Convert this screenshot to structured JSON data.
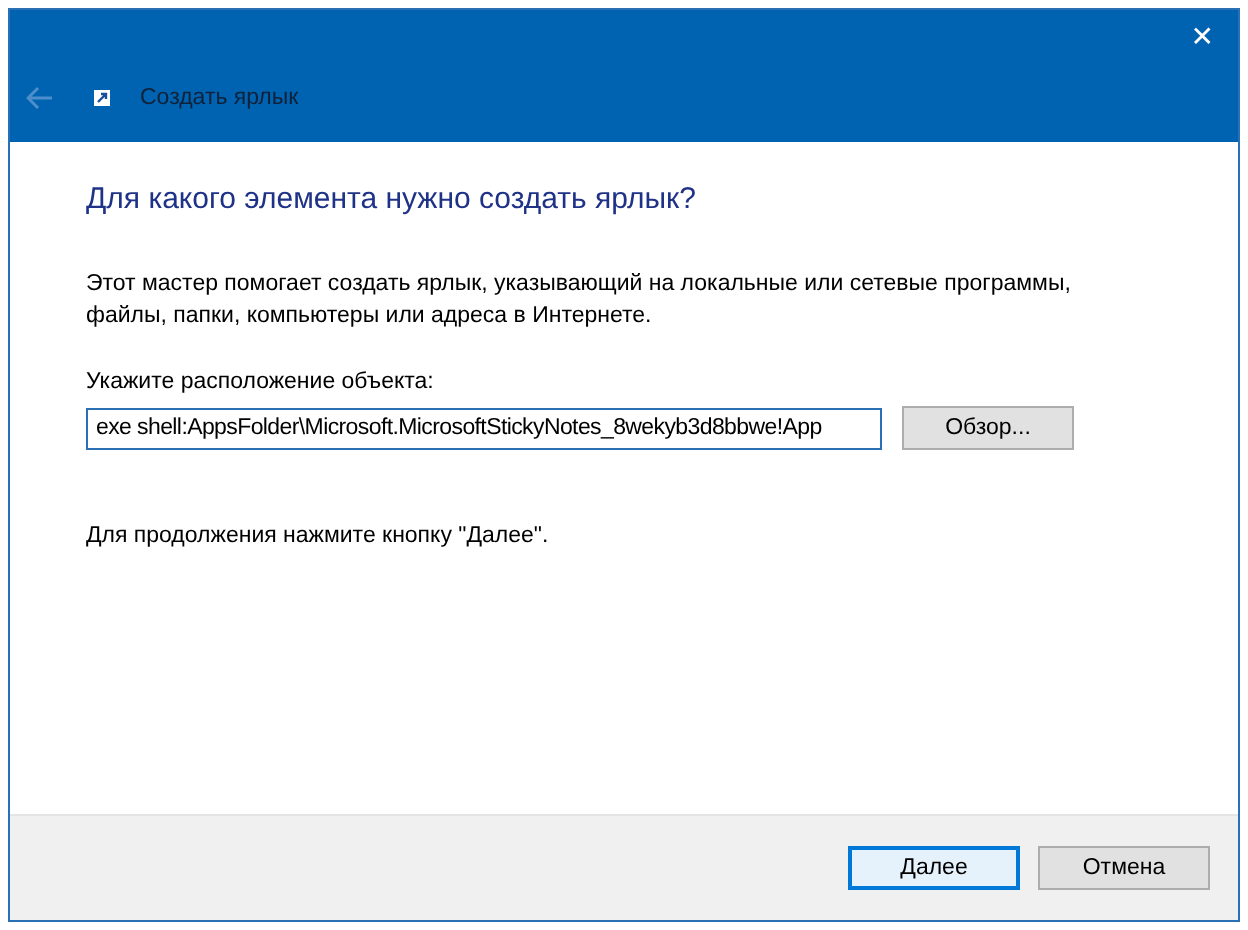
{
  "window": {
    "close": "✕"
  },
  "back_button": {
    "disabled": true
  },
  "title": "Создать ярлык",
  "heading": "Для какого элемента нужно создать ярлык?",
  "description": "Этот мастер помогает создать ярлык, указывающий на локальные или сетевые программы, файлы, папки, компьютеры или адреса в Интернете.",
  "location": {
    "label": "Укажите расположение объекта:",
    "value": "exe shell:AppsFolder\\Microsoft.MicrosoftStickyNotes_8wekyb3d8bbwe!App",
    "browse": "Обзор..."
  },
  "hint": "Для продолжения нажмите кнопку \"Далее\".",
  "buttons": [
    {
      "label": "Далее",
      "default": true
    },
    {
      "label": "Отмена",
      "default": false
    }
  ]
}
